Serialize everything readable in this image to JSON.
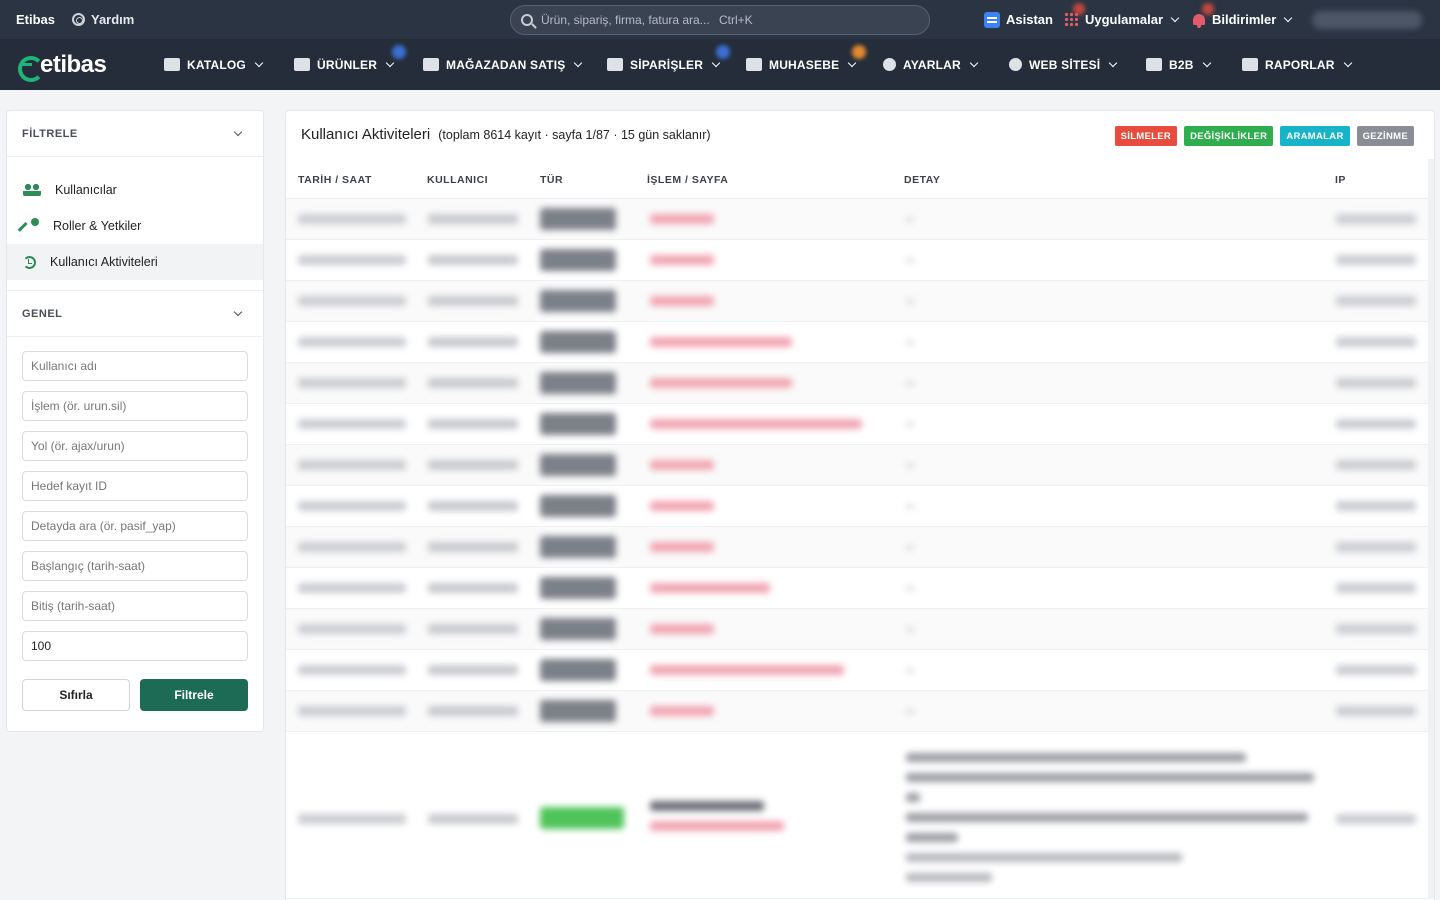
{
  "topbar": {
    "brand": "Etibas",
    "help": "Yardım",
    "search_placeholder": "Ürün, sipariş, firma, fatura ara...",
    "search_shortcut": "Ctrl+K",
    "assistant": "Asistan",
    "apps": "Uygulamalar",
    "notifications": "Bildirimler",
    "accent": "#2b3443"
  },
  "nav": {
    "logo": "etibas",
    "items": [
      {
        "label": "KATALOG",
        "icon": "books-icon"
      },
      {
        "label": "ÜRÜNLER",
        "icon": "tag-icon"
      },
      {
        "label": "MAĞAZADAN SATIŞ",
        "icon": "store-icon"
      },
      {
        "label": "SİPARİŞLER",
        "icon": "cart-icon"
      },
      {
        "label": "MUHASEBE",
        "icon": "calculator-icon"
      },
      {
        "label": "AYARLAR",
        "icon": "gear-icon"
      },
      {
        "label": "WEB SİTESİ",
        "icon": "globe-icon"
      },
      {
        "label": "B2B",
        "icon": "shop-icon"
      },
      {
        "label": "RAPORLAR",
        "icon": "report-icon"
      }
    ]
  },
  "sidebar": {
    "filter_title": "FİLTRELE",
    "menu": [
      {
        "label": "Kullanıcılar",
        "icon": "users-icon"
      },
      {
        "label": "Roller & Yetkiler",
        "icon": "key-icon"
      },
      {
        "label": "Kullanıcı Aktiviteleri",
        "icon": "history-icon"
      }
    ],
    "general_title": "GENEL",
    "fields": {
      "username": "Kullanıcı adı",
      "action": "İşlem (ör. urun.sil)",
      "path": "Yol (ör. ajax/urun)",
      "target_id": "Hedef kayıt ID",
      "detail": "Detayda ara (ör. pasif_yap)",
      "start": "Başlangıç (tarih-saat)",
      "end": "Bitiş (tarih-saat)",
      "limit_value": "100"
    },
    "reset_label": "Sıfırla",
    "filter_label": "Filtrele"
  },
  "main": {
    "title": "Kullanıcı Aktiviteleri",
    "subtitle": "(toplam 8614 kayıt · sayfa 1/87 · 15 gün saklanır)",
    "tags": [
      {
        "label": "SİLMELER",
        "color": "#e74c3c"
      },
      {
        "label": "DEĞİŞİKLİKLER",
        "color": "#2eae4f"
      },
      {
        "label": "ARAMALAR",
        "color": "#17b3c9"
      },
      {
        "label": "GEZİNME",
        "color": "#8a8d93"
      }
    ],
    "columns": {
      "date": "TARİH / SAAT",
      "user": "KULLANICI",
      "type": "TÜR",
      "op": "İŞLEM / SAYFA",
      "detail": "DETAY",
      "ip": "IP"
    }
  }
}
